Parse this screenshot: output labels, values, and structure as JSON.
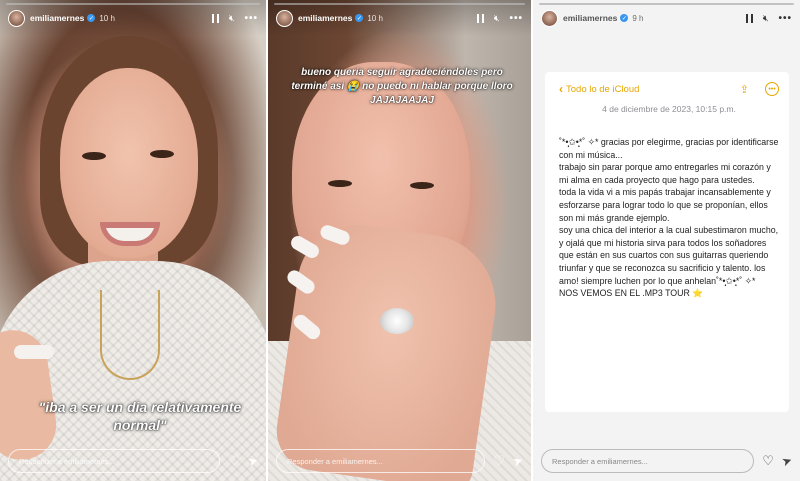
{
  "stories": [
    {
      "username": "emiliamernes",
      "time": "10 h",
      "reply_placeholder": "Responder a emiliamernes...",
      "caption": "\"iba a ser un dia relativamente normal\""
    },
    {
      "username": "emiliamernes",
      "time": "10 h",
      "reply_placeholder": "Responder a emiliamernes...",
      "caption": "bueno queria seguir agradeciéndoles pero terminé asi 😭 no puedo ni hablar porque lloro JAJAJAAJAJ"
    },
    {
      "username": "emiliamernes",
      "time": "9 h",
      "reply_placeholder": "Responder a emiliamernes...",
      "note": {
        "folder": "Todo lo de iCloud",
        "date": "4 de diciembre de 2023, 10:15 p.m.",
        "lines": [
          "˚*•̩̩͙✩•̩̩͙*˚ ✧* gracias por elegirme, gracias por identificarse con mi música...",
          "trabajo sin parar porque amo entregarles mi corazón y mi alma en cada proyecto que hago para ustedes.",
          "toda la vida vi a mis papás trabajar incansablemente y esforzarse para lograr todo lo que se proponían, ellos son mi más grande ejemplo.",
          "soy una chica del interior a la cual subestimaron mucho, y ojalá que mi historia sirva para todos los soñadores que están en sus cuartos con sus guitarras queriendo triunfar y que se reconozca su sacrificio y talento. los amo! siempre luchen por lo que anhelan˚*•̩̩͙✩•̩̩͙*˚ ✧*",
          "NOS VEMOS EN EL .MP3 TOUR ⭐"
        ]
      }
    }
  ],
  "icons": {
    "pause": "pause-icon",
    "sound": "sound-off-icon",
    "more": "more-icon",
    "heart": "heart-icon",
    "send": "send-icon"
  },
  "colors": {
    "notes_accent": "#e6a700",
    "verified": "#3897f0"
  }
}
